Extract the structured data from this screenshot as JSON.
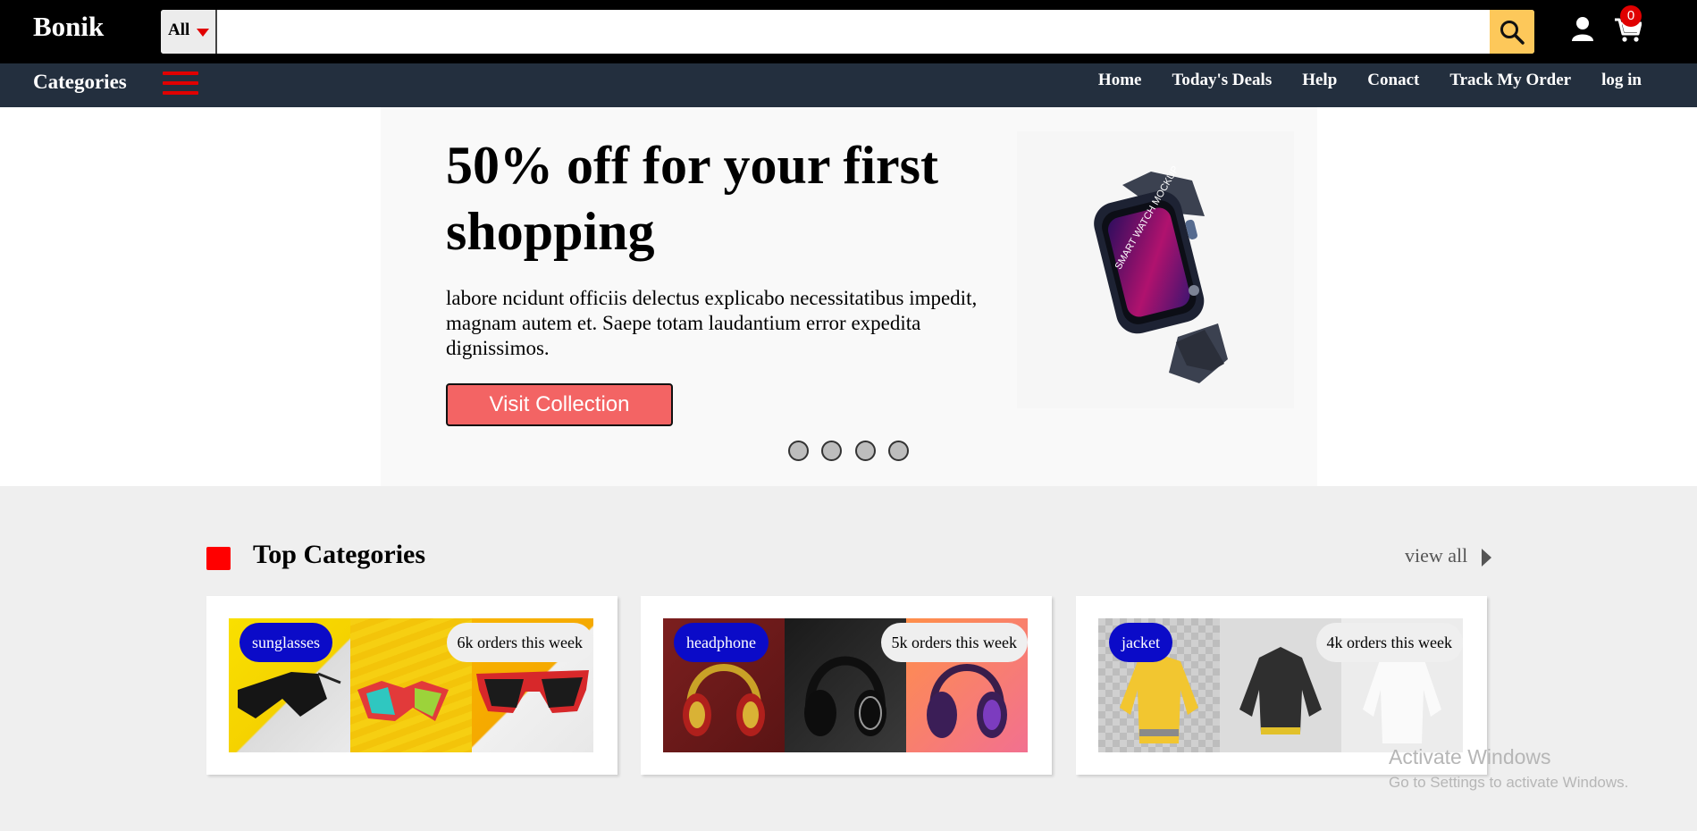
{
  "header": {
    "brand": "Bonik",
    "search_category": "All",
    "search_placeholder": "",
    "cart_count": "0"
  },
  "nav": {
    "categories_label": "Categories",
    "links": [
      "Home",
      "Today's Deals",
      "Help",
      "Conact",
      "Track My Order",
      "log in"
    ]
  },
  "hero": {
    "title": "50% off for your first shopping",
    "text": "labore ncidunt officiis delectus explicabo necessitatibus impedit, magnam autem et. Saepe totam laudantium error expedita dignissimos.",
    "button": "Visit Collection",
    "image_screen_text": "SMART WATCH MOCKUP",
    "slide_count": 4
  },
  "top_categories": {
    "title": "Top Categories",
    "view_all": "view all",
    "cards": [
      {
        "tag": "sunglasses",
        "orders": "6k orders this week"
      },
      {
        "tag": "headphone",
        "orders": "5k orders this week"
      },
      {
        "tag": "jacket",
        "orders": "4k orders this week"
      }
    ]
  },
  "watermark": {
    "line1": "Activate Windows",
    "line2": "Go to Settings to activate Windows."
  },
  "colors": {
    "accent": "#ff0000",
    "topbar": "#000000",
    "navbar": "#232f3e",
    "search_button": "#fdc85a",
    "hero_button": "#f36464",
    "tag": "#0b0bc8"
  }
}
